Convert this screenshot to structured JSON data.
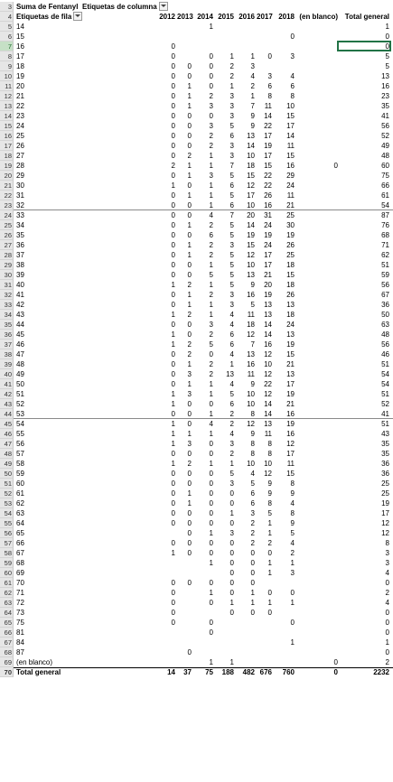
{
  "pivot": {
    "title": "Suma de Fentanyl",
    "col_labels_title": "Etiquetas de columna",
    "row_labels_title": "Etiquetas de fila",
    "filter_icon": "dropdown-filter-icon",
    "columns": [
      "2012",
      "2013",
      "2014",
      "2015",
      "2016",
      "2017",
      "2018",
      "(en blanco)",
      "Total general"
    ],
    "header_row_nums": [
      "3",
      "4"
    ],
    "rows": [
      {
        "n": "5",
        "label": "14",
        "v": [
          "",
          "",
          "1",
          "",
          "",
          "",
          "",
          "",
          "1"
        ]
      },
      {
        "n": "6",
        "label": "15",
        "v": [
          "",
          "",
          "",
          "",
          "",
          "",
          "0",
          "",
          "0"
        ]
      },
      {
        "n": "7",
        "label": "16",
        "v": [
          "0",
          "",
          "",
          "",
          "",
          "",
          "",
          "",
          "0"
        ]
      },
      {
        "n": "8",
        "label": "17",
        "v": [
          "0",
          "",
          "0",
          "1",
          "1",
          "0",
          "3",
          "",
          "5"
        ]
      },
      {
        "n": "9",
        "label": "18",
        "v": [
          "0",
          "0",
          "0",
          "2",
          "3",
          "",
          "",
          "",
          "5"
        ]
      },
      {
        "n": "10",
        "label": "19",
        "v": [
          "0",
          "0",
          "0",
          "2",
          "4",
          "3",
          "4",
          "",
          "13"
        ]
      },
      {
        "n": "11",
        "label": "20",
        "v": [
          "0",
          "1",
          "0",
          "1",
          "2",
          "6",
          "6",
          "",
          "16"
        ]
      },
      {
        "n": "12",
        "label": "21",
        "v": [
          "0",
          "1",
          "2",
          "3",
          "1",
          "8",
          "8",
          "",
          "23"
        ]
      },
      {
        "n": "13",
        "label": "22",
        "v": [
          "0",
          "1",
          "3",
          "3",
          "7",
          "11",
          "10",
          "",
          "35"
        ]
      },
      {
        "n": "14",
        "label": "23",
        "v": [
          "0",
          "0",
          "0",
          "3",
          "9",
          "14",
          "15",
          "",
          "41"
        ]
      },
      {
        "n": "15",
        "label": "24",
        "v": [
          "0",
          "0",
          "3",
          "5",
          "9",
          "22",
          "17",
          "",
          "56"
        ]
      },
      {
        "n": "16",
        "label": "25",
        "v": [
          "0",
          "0",
          "2",
          "6",
          "13",
          "17",
          "14",
          "",
          "52"
        ]
      },
      {
        "n": "17",
        "label": "26",
        "v": [
          "0",
          "0",
          "2",
          "3",
          "14",
          "19",
          "11",
          "",
          "49"
        ]
      },
      {
        "n": "18",
        "label": "27",
        "v": [
          "0",
          "2",
          "1",
          "3",
          "10",
          "17",
          "15",
          "",
          "48"
        ]
      },
      {
        "n": "19",
        "label": "28",
        "v": [
          "2",
          "1",
          "1",
          "7",
          "18",
          "15",
          "16",
          "0",
          "60"
        ]
      },
      {
        "n": "20",
        "label": "29",
        "v": [
          "0",
          "1",
          "3",
          "5",
          "15",
          "22",
          "29",
          "",
          "75"
        ]
      },
      {
        "n": "21",
        "label": "30",
        "v": [
          "1",
          "0",
          "1",
          "6",
          "12",
          "22",
          "24",
          "",
          "66"
        ]
      },
      {
        "n": "22",
        "label": "31",
        "v": [
          "0",
          "1",
          "1",
          "5",
          "17",
          "26",
          "11",
          "",
          "61"
        ]
      },
      {
        "n": "23",
        "label": "32",
        "v": [
          "0",
          "0",
          "1",
          "6",
          "10",
          "16",
          "21",
          "",
          "54"
        ]
      },
      {
        "n": "24",
        "label": "33",
        "v": [
          "0",
          "0",
          "4",
          "7",
          "20",
          "31",
          "25",
          "",
          "87"
        ]
      },
      {
        "n": "25",
        "label": "34",
        "v": [
          "0",
          "1",
          "2",
          "5",
          "14",
          "24",
          "30",
          "",
          "76"
        ]
      },
      {
        "n": "26",
        "label": "35",
        "v": [
          "0",
          "0",
          "6",
          "5",
          "19",
          "19",
          "19",
          "",
          "68"
        ]
      },
      {
        "n": "27",
        "label": "36",
        "v": [
          "0",
          "1",
          "2",
          "3",
          "15",
          "24",
          "26",
          "",
          "71"
        ]
      },
      {
        "n": "28",
        "label": "37",
        "v": [
          "0",
          "1",
          "2",
          "5",
          "12",
          "17",
          "25",
          "",
          "62"
        ]
      },
      {
        "n": "29",
        "label": "38",
        "v": [
          "0",
          "0",
          "1",
          "5",
          "10",
          "17",
          "18",
          "",
          "51"
        ]
      },
      {
        "n": "30",
        "label": "39",
        "v": [
          "0",
          "0",
          "5",
          "5",
          "13",
          "21",
          "15",
          "",
          "59"
        ]
      },
      {
        "n": "31",
        "label": "40",
        "v": [
          "1",
          "2",
          "1",
          "5",
          "9",
          "20",
          "18",
          "",
          "56"
        ]
      },
      {
        "n": "32",
        "label": "41",
        "v": [
          "0",
          "1",
          "2",
          "3",
          "16",
          "19",
          "26",
          "",
          "67"
        ]
      },
      {
        "n": "33",
        "label": "42",
        "v": [
          "0",
          "1",
          "1",
          "3",
          "5",
          "13",
          "13",
          "",
          "36"
        ]
      },
      {
        "n": "34",
        "label": "43",
        "v": [
          "1",
          "2",
          "1",
          "4",
          "11",
          "13",
          "18",
          "",
          "50"
        ]
      },
      {
        "n": "35",
        "label": "44",
        "v": [
          "0",
          "0",
          "3",
          "4",
          "18",
          "14",
          "24",
          "",
          "63"
        ]
      },
      {
        "n": "36",
        "label": "45",
        "v": [
          "1",
          "0",
          "2",
          "6",
          "12",
          "14",
          "13",
          "",
          "48"
        ]
      },
      {
        "n": "37",
        "label": "46",
        "v": [
          "1",
          "2",
          "5",
          "6",
          "7",
          "16",
          "19",
          "",
          "56"
        ]
      },
      {
        "n": "38",
        "label": "47",
        "v": [
          "0",
          "2",
          "0",
          "4",
          "13",
          "12",
          "15",
          "",
          "46"
        ]
      },
      {
        "n": "39",
        "label": "48",
        "v": [
          "0",
          "1",
          "2",
          "1",
          "16",
          "10",
          "21",
          "",
          "51"
        ]
      },
      {
        "n": "40",
        "label": "49",
        "v": [
          "0",
          "3",
          "2",
          "13",
          "11",
          "12",
          "13",
          "",
          "54"
        ]
      },
      {
        "n": "41",
        "label": "50",
        "v": [
          "0",
          "1",
          "1",
          "4",
          "9",
          "22",
          "17",
          "",
          "54"
        ]
      },
      {
        "n": "42",
        "label": "51",
        "v": [
          "1",
          "3",
          "1",
          "5",
          "10",
          "12",
          "19",
          "",
          "51"
        ]
      },
      {
        "n": "43",
        "label": "52",
        "v": [
          "1",
          "0",
          "0",
          "6",
          "10",
          "14",
          "21",
          "",
          "52"
        ]
      },
      {
        "n": "44",
        "label": "53",
        "v": [
          "0",
          "0",
          "1",
          "2",
          "8",
          "14",
          "16",
          "",
          "41"
        ]
      },
      {
        "n": "45",
        "label": "54",
        "v": [
          "1",
          "0",
          "4",
          "2",
          "12",
          "13",
          "19",
          "",
          "51"
        ]
      },
      {
        "n": "46",
        "label": "55",
        "v": [
          "1",
          "1",
          "1",
          "4",
          "9",
          "11",
          "16",
          "",
          "43"
        ]
      },
      {
        "n": "47",
        "label": "56",
        "v": [
          "1",
          "3",
          "0",
          "3",
          "8",
          "8",
          "12",
          "",
          "35"
        ]
      },
      {
        "n": "48",
        "label": "57",
        "v": [
          "0",
          "0",
          "0",
          "2",
          "8",
          "8",
          "17",
          "",
          "35"
        ]
      },
      {
        "n": "49",
        "label": "58",
        "v": [
          "1",
          "2",
          "1",
          "1",
          "10",
          "10",
          "11",
          "",
          "36"
        ]
      },
      {
        "n": "50",
        "label": "59",
        "v": [
          "0",
          "0",
          "0",
          "5",
          "4",
          "12",
          "15",
          "",
          "36"
        ]
      },
      {
        "n": "51",
        "label": "60",
        "v": [
          "0",
          "0",
          "0",
          "3",
          "5",
          "9",
          "8",
          "",
          "25"
        ]
      },
      {
        "n": "52",
        "label": "61",
        "v": [
          "0",
          "1",
          "0",
          "0",
          "6",
          "9",
          "9",
          "",
          "25"
        ]
      },
      {
        "n": "53",
        "label": "62",
        "v": [
          "0",
          "1",
          "0",
          "0",
          "6",
          "8",
          "4",
          "",
          "19"
        ]
      },
      {
        "n": "54",
        "label": "63",
        "v": [
          "0",
          "0",
          "0",
          "1",
          "3",
          "5",
          "8",
          "",
          "17"
        ]
      },
      {
        "n": "55",
        "label": "64",
        "v": [
          "0",
          "0",
          "0",
          "0",
          "2",
          "1",
          "9",
          "",
          "12"
        ]
      },
      {
        "n": "56",
        "label": "65",
        "v": [
          "",
          "0",
          "1",
          "3",
          "2",
          "1",
          "5",
          "",
          "12"
        ]
      },
      {
        "n": "57",
        "label": "66",
        "v": [
          "0",
          "0",
          "0",
          "0",
          "2",
          "2",
          "4",
          "",
          "8"
        ]
      },
      {
        "n": "58",
        "label": "67",
        "v": [
          "1",
          "0",
          "0",
          "0",
          "0",
          "0",
          "2",
          "",
          "3"
        ]
      },
      {
        "n": "59",
        "label": "68",
        "v": [
          "",
          "",
          "1",
          "0",
          "0",
          "1",
          "1",
          "",
          "3"
        ]
      },
      {
        "n": "60",
        "label": "69",
        "v": [
          "",
          "",
          "",
          "0",
          "0",
          "1",
          "3",
          "",
          "4"
        ]
      },
      {
        "n": "61",
        "label": "70",
        "v": [
          "0",
          "0",
          "0",
          "0",
          "0",
          "",
          "",
          "",
          "0"
        ]
      },
      {
        "n": "62",
        "label": "71",
        "v": [
          "0",
          "",
          "1",
          "0",
          "1",
          "0",
          "0",
          "",
          "2"
        ]
      },
      {
        "n": "63",
        "label": "72",
        "v": [
          "0",
          "",
          "0",
          "1",
          "1",
          "1",
          "1",
          "",
          "4"
        ]
      },
      {
        "n": "64",
        "label": "73",
        "v": [
          "0",
          "",
          "",
          "0",
          "0",
          "0",
          "",
          "",
          "0"
        ]
      },
      {
        "n": "65",
        "label": "75",
        "v": [
          "0",
          "",
          "0",
          "",
          "",
          "",
          "0",
          "",
          "0"
        ]
      },
      {
        "n": "66",
        "label": "81",
        "v": [
          "",
          "",
          "0",
          "",
          "",
          "",
          "",
          "",
          "0"
        ]
      },
      {
        "n": "67",
        "label": "84",
        "v": [
          "",
          "",
          "",
          "",
          "",
          "",
          "1",
          "",
          "1"
        ]
      },
      {
        "n": "68",
        "label": "87",
        "v": [
          "",
          "0",
          "",
          "",
          "",
          "",
          "",
          "",
          "0"
        ]
      },
      {
        "n": "69",
        "label": "(en blanco)",
        "v": [
          "",
          "",
          "1",
          "1",
          "",
          "",
          "",
          "0",
          "2"
        ]
      }
    ],
    "total": {
      "n": "70",
      "label": "Total general",
      "v": [
        "14",
        "37",
        "75",
        "188",
        "482",
        "676",
        "760",
        "0",
        "2232"
      ]
    }
  },
  "selection": {
    "row": "7",
    "column": "Total general"
  }
}
